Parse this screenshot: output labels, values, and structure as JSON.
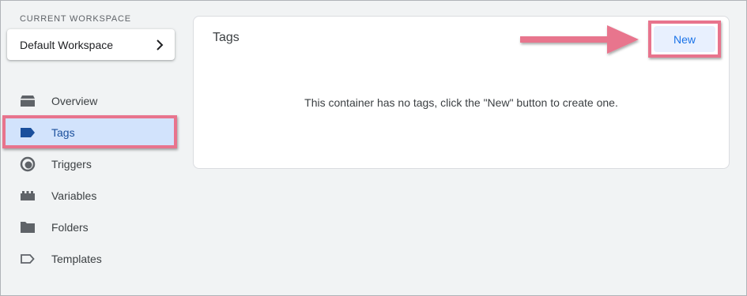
{
  "sidebar": {
    "workspace_label": "CURRENT WORKSPACE",
    "workspace_name": "Default Workspace",
    "items": [
      {
        "label": "Overview",
        "icon": "overview-icon"
      },
      {
        "label": "Tags",
        "icon": "tag-icon",
        "active": true
      },
      {
        "label": "Triggers",
        "icon": "triggers-icon"
      },
      {
        "label": "Variables",
        "icon": "variables-icon"
      },
      {
        "label": "Folders",
        "icon": "folder-icon"
      },
      {
        "label": "Templates",
        "icon": "template-icon"
      }
    ]
  },
  "main": {
    "title": "Tags",
    "new_button": "New",
    "empty_message": "This container has no tags, click the \"New\" button to create one."
  },
  "colors": {
    "highlight": "#e8748d",
    "active_bg": "#d2e3fc",
    "accent": "#1a73e8",
    "background": "#f1f3f4"
  }
}
